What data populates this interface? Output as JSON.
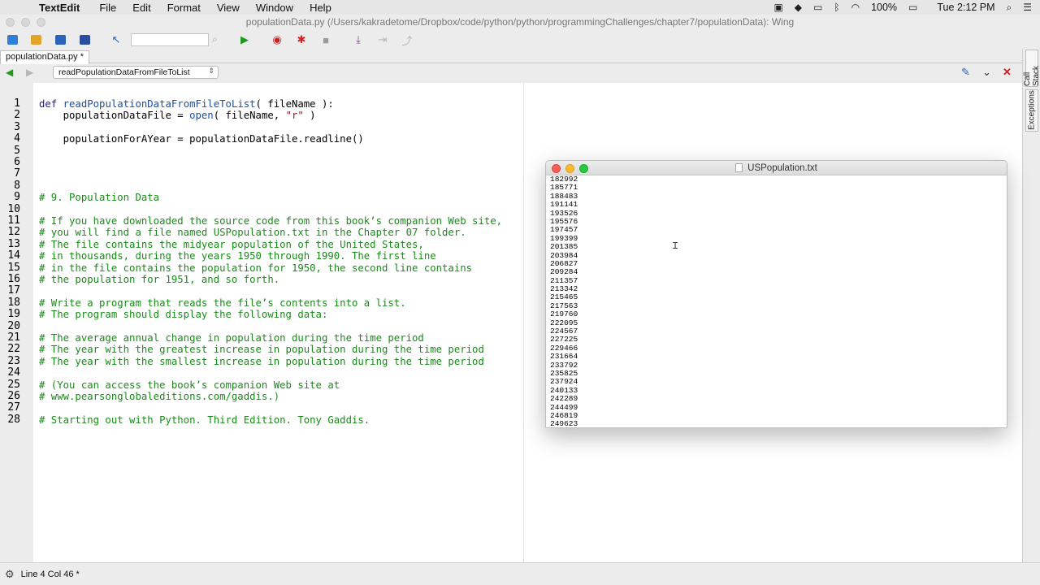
{
  "menubar": {
    "app": "TextEdit",
    "items": [
      "File",
      "Edit",
      "Format",
      "View",
      "Window",
      "Help"
    ],
    "battery": "100%",
    "clock": "Tue 2:12 PM"
  },
  "window": {
    "title": "populationData.py (/Users/kakradetome/Dropbox/code/python/python/programmingChallenges/chapter7/populationData): Wing"
  },
  "tab": {
    "label": "populationData.py *"
  },
  "nav": {
    "function_selector": "readPopulationDataFromFileToList"
  },
  "editor": {
    "line_numbers": [
      "1",
      "2",
      "3",
      "4",
      "5",
      "6",
      "7",
      "8",
      "9",
      "10",
      "11",
      "12",
      "13",
      "14",
      "15",
      "16",
      "17",
      "18",
      "19",
      "20",
      "21",
      "22",
      "23",
      "24",
      "25",
      "26",
      "27",
      "28"
    ],
    "lines": [
      [
        {
          "t": "def ",
          "c": "kw"
        },
        {
          "t": "readPopulationDataFromFileToList",
          "c": "fn"
        },
        {
          "t": "( fileName ):",
          "c": "plain"
        }
      ],
      [
        {
          "t": "    populationDataFile = ",
          "c": "plain"
        },
        {
          "t": "open",
          "c": "fn"
        },
        {
          "t": "( fileName, ",
          "c": "plain"
        },
        {
          "t": "\"r\"",
          "c": "str"
        },
        {
          "t": " )",
          "c": "plain"
        }
      ],
      [],
      [
        {
          "t": "    populationForAYear = populationDataFile.readline()",
          "c": "plain"
        }
      ],
      [],
      [],
      [],
      [],
      [
        {
          "t": "# 9. Population Data",
          "c": "cm"
        }
      ],
      [],
      [
        {
          "t": "# If you have downloaded the source code from this book’s companion Web site,",
          "c": "cm"
        }
      ],
      [
        {
          "t": "# you will find a file named USPopulation.txt in the Chapter 07 folder.",
          "c": "cm"
        }
      ],
      [
        {
          "t": "# The file contains the midyear population of the United States,",
          "c": "cm"
        }
      ],
      [
        {
          "t": "# in thousands, during the years 1950 through 1990. The first line",
          "c": "cm"
        }
      ],
      [
        {
          "t": "# in the file contains the population for 1950, the second line contains",
          "c": "cm"
        }
      ],
      [
        {
          "t": "# the population for 1951, and so forth.",
          "c": "cm"
        }
      ],
      [],
      [
        {
          "t": "# Write a program that reads the file’s contents into a list.",
          "c": "cm"
        }
      ],
      [
        {
          "t": "# The program should display the following data:",
          "c": "cm"
        }
      ],
      [],
      [
        {
          "t": "# The average annual change in population during the time period",
          "c": "cm"
        }
      ],
      [
        {
          "t": "# The year with the greatest increase in population during the time period",
          "c": "cm"
        }
      ],
      [
        {
          "t": "# The year with the smallest increase in population during the time period",
          "c": "cm"
        }
      ],
      [],
      [
        {
          "t": "# (You can access the book’s companion Web site at",
          "c": "cm"
        }
      ],
      [
        {
          "t": "# www.pearsonglobaleditions.com/gaddis.)",
          "c": "cm"
        }
      ],
      [],
      [
        {
          "t": "# Starting out with Python. Third Edition. Tony Gaddis.",
          "c": "cm"
        }
      ]
    ]
  },
  "side_tabs": [
    "Call Stack",
    "Exceptions"
  ],
  "status": {
    "text": "Line 4 Col 46 *"
  },
  "textedit": {
    "title": "USPopulation.txt",
    "values": [
      "182992",
      "185771",
      "188483",
      "191141",
      "193526",
      "195576",
      "197457",
      "199399",
      "201385",
      "203984",
      "206827",
      "209284",
      "211357",
      "213342",
      "215465",
      "217563",
      "219760",
      "222095",
      "224567",
      "227225",
      "229466",
      "231664",
      "233792",
      "235825",
      "237924",
      "240133",
      "242289",
      "244499",
      "246819",
      "249623"
    ]
  }
}
